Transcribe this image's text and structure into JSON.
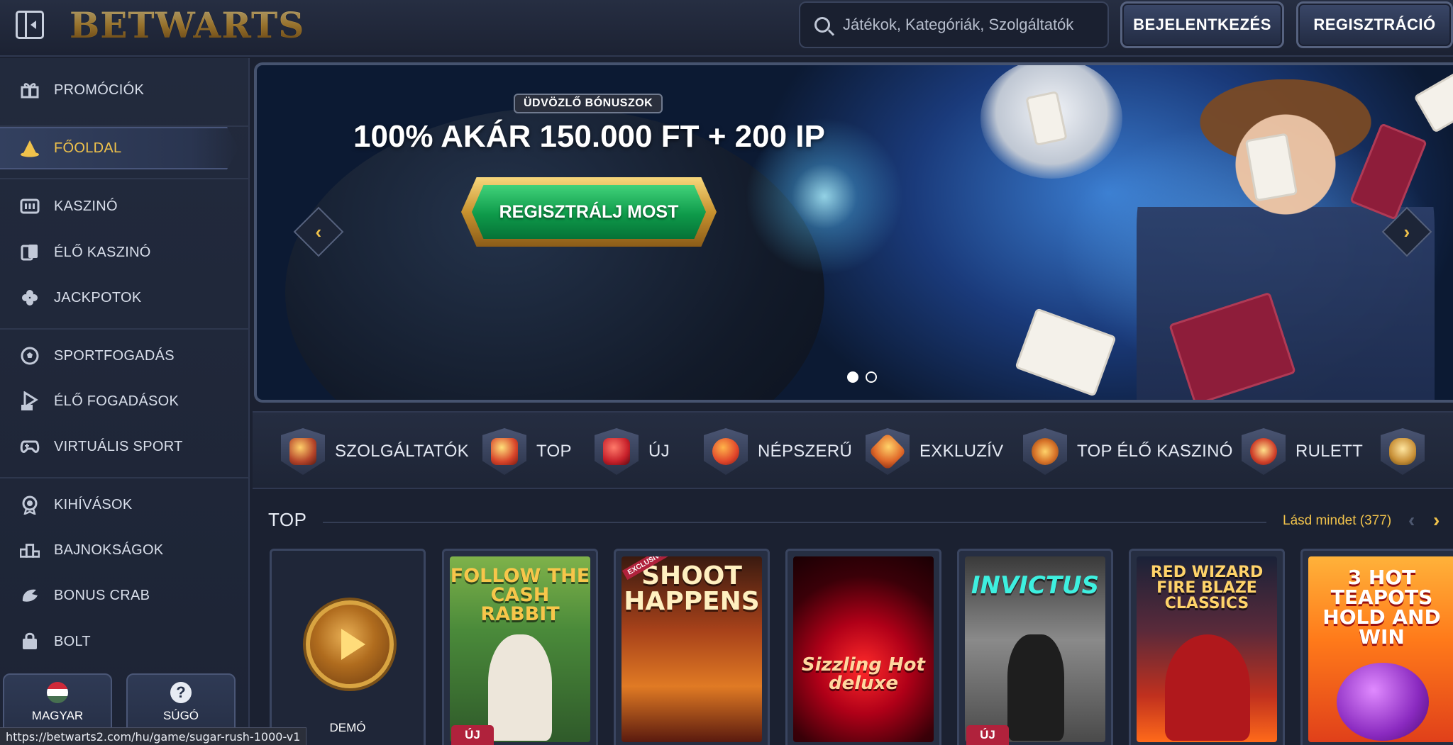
{
  "header": {
    "logo_text": "BETWARTS",
    "search_placeholder": "Játékok, Kategóriák, Szolgáltatók",
    "login_label": "BEJELENTKEZÉS",
    "register_label": "REGISZTRÁCIÓ"
  },
  "sidebar": {
    "items": [
      {
        "label": "PROMÓCIÓK",
        "icon": "gift-icon"
      },
      {
        "label": "FŐOLDAL",
        "icon": "wizard-hat-icon",
        "active": true
      },
      {
        "label": "KASZINÓ",
        "icon": "slot-machine-icon"
      },
      {
        "label": "ÉLŐ KASZINÓ",
        "icon": "live-cards-icon"
      },
      {
        "label": "JACKPOTOK",
        "icon": "clover-icon"
      },
      {
        "label": "SPORTFOGADÁS",
        "icon": "soccer-ball-icon"
      },
      {
        "label": "ÉLŐ FOGADÁSOK",
        "icon": "live-tv-icon"
      },
      {
        "label": "VIRTUÁLIS SPORT",
        "icon": "gamepad-icon"
      },
      {
        "label": "KIHÍVÁSOK",
        "icon": "medal-icon"
      },
      {
        "label": "BAJNOKSÁGOK",
        "icon": "podium-icon"
      },
      {
        "label": "BONUS CRAB",
        "icon": "crab-claw-icon"
      },
      {
        "label": "BOLT",
        "icon": "shopping-bag-icon"
      }
    ],
    "language_label": "MAGYAR",
    "help_label": "SÚGÓ"
  },
  "hero": {
    "badge": "ÜDVÖZLŐ BÓNUSZOK",
    "title": "100% AKÁR 150.000 FT + 200 IP",
    "cta": "REGISZTRÁLJ MOST",
    "prev_icon": "‹",
    "next_icon": "›",
    "active_slide": 1,
    "slide_count": 2
  },
  "categories": [
    {
      "label": "SZOLGÁLTATÓK",
      "icon": "providers-icon"
    },
    {
      "label": "TOP",
      "icon": "crown-icon"
    },
    {
      "label": "ÚJ",
      "icon": "lightning-icon"
    },
    {
      "label": "NÉPSZERŰ",
      "icon": "cherries-icon"
    },
    {
      "label": "EXKLUZÍV",
      "icon": "gem-icon"
    },
    {
      "label": "TOP ÉLŐ KASZINÓ",
      "icon": "chip-icon"
    },
    {
      "label": "RULETT",
      "icon": "roulette-icon"
    },
    {
      "label": "",
      "icon": "microphone-icon"
    }
  ],
  "top_section": {
    "title": "TOP",
    "see_all": "Lásd mindet (377)",
    "demo_label": "DEMÓ",
    "games": [
      {
        "title": "FOLLOW THE CASH RABBIT",
        "badge": "ÚJ"
      },
      {
        "title": "SHOOT HAPPENS",
        "badge": "EXCLUSIVE"
      },
      {
        "title": "Sizzling Hot deluxe",
        "badge": ""
      },
      {
        "title": "INVICTUS",
        "badge": "ÚJ"
      },
      {
        "title": "RED WIZARD FIRE BLAZE CLASSICS",
        "badge": ""
      },
      {
        "title": "3 HOT TEAPOTS HOLD AND WIN",
        "badge": ""
      }
    ]
  },
  "status_url": "https://betwarts2.com/hu/game/sugar-rush-1000-v1",
  "colors": {
    "accent_gold": "#f0c24b",
    "background": "#1b2131",
    "cta_green": "#0e9a4a",
    "new_badge": "#b0223c"
  }
}
